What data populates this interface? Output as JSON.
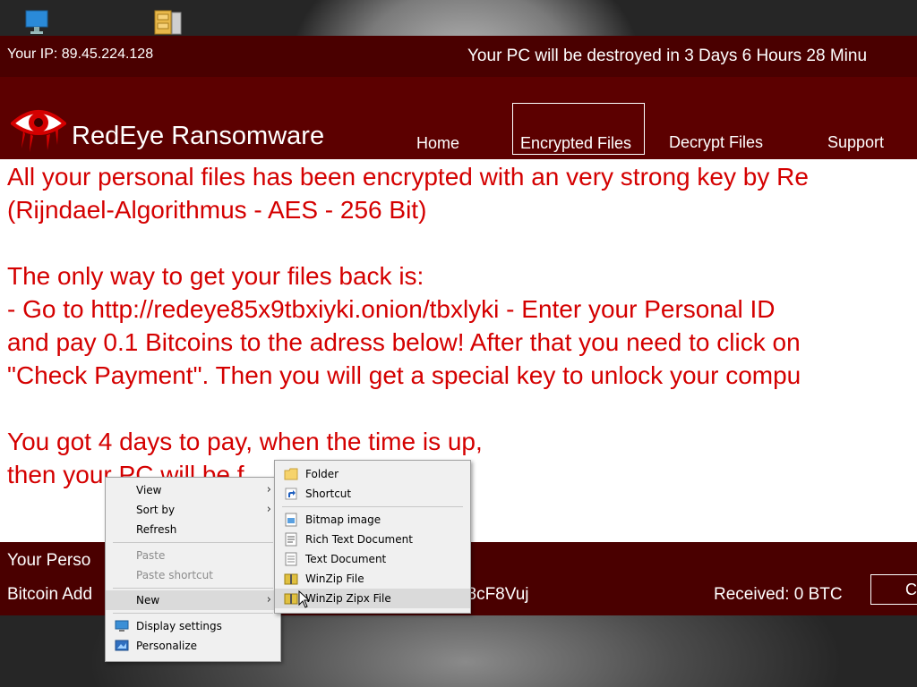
{
  "window": {
    "ip_text": "Your IP: 89.45.224.128",
    "countdown_text": "Your PC will be destroyed in 3 Days 6 Hours 28 Minu",
    "brand": "RedEye Ransomware",
    "nav": {
      "home": "Home",
      "encrypted_files": "Encrypted Files",
      "decrypt_files": "Decrypt Files",
      "support": "Support"
    },
    "message_lines": [
      "All your personal files has been encrypted with an very strong key by Re",
      "(Rijndael-Algorithmus -  AES - 256 Bit)",
      "",
      "The only way to get your files back is:",
      "- Go to http://redeye85x9tbxiyki.onion/tbxlyki - Enter your Personal ID",
      "and pay 0.1 Bitcoins to the adress below! After that you need to click on",
      " \"Check Payment\". Then you will get a special key to unlock your compu",
      "",
      "You got 4 days to pay, when the time is up,",
      "then your PC will be f"
    ],
    "footer": {
      "personal_id_label": "Your Perso",
      "bitcoin_label": "Bitcoin Add",
      "bitcoin_address_tail": "k8cF8Vuj",
      "received": "Received: 0 BTC",
      "check_button": "C"
    }
  },
  "context_menu": {
    "items": [
      {
        "label": "View",
        "submenu": true,
        "disabled": false
      },
      {
        "label": "Sort by",
        "submenu": true,
        "disabled": false
      },
      {
        "label": "Refresh",
        "submenu": false,
        "disabled": false
      },
      {
        "label": "Paste",
        "submenu": false,
        "disabled": true
      },
      {
        "label": "Paste shortcut",
        "submenu": false,
        "disabled": true
      },
      {
        "label": "New",
        "submenu": true,
        "disabled": false,
        "highlighted": true
      },
      {
        "label": "Display settings",
        "submenu": false,
        "disabled": false,
        "icon": "display-icon"
      },
      {
        "label": "Personalize",
        "submenu": false,
        "disabled": false,
        "icon": "personalize-icon"
      }
    ]
  },
  "new_submenu": {
    "items": [
      {
        "label": "Folder",
        "icon": "folder-icon"
      },
      {
        "label": "Shortcut",
        "icon": "shortcut-icon"
      },
      {
        "label": "Bitmap image",
        "icon": "bitmap-icon"
      },
      {
        "label": "Rich Text Document",
        "icon": "rtf-document-icon"
      },
      {
        "label": "Text Document",
        "icon": "text-document-icon"
      },
      {
        "label": "WinZip File",
        "icon": "winzip-icon"
      },
      {
        "label": "WinZip Zipx File",
        "icon": "winzip-zipx-icon",
        "highlighted": true
      }
    ]
  },
  "colors": {
    "bar_dark": "#4a0000",
    "header_red": "#5c0000",
    "message_red": "#d40000"
  }
}
